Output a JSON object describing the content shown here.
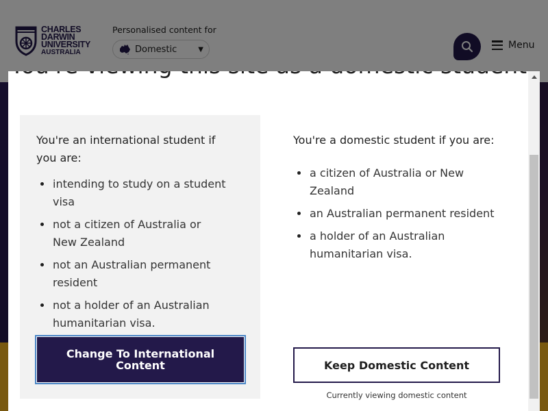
{
  "header": {
    "logo": {
      "line1": "CHARLES",
      "line2": "DARWIN",
      "line3": "UNIVERSITY",
      "line4": "AUSTRALIA"
    },
    "personalise_label": "Personalised content for",
    "audience_select": {
      "selected": "Domestic",
      "icon": "australia-map-icon"
    },
    "search_icon": "search-icon",
    "menu_label": "Menu",
    "brand_color": "#23194a",
    "accent_color": "#f2b321"
  },
  "modal": {
    "heading": "You're viewing this site as a domestic student",
    "international": {
      "title": "You're an international student if you are:",
      "items": [
        "intending to study on a student visa",
        "not a citizen of Australia or New Zealand",
        "not an Australian permanent resident",
        "not a holder of an Australian humanitarian visa."
      ],
      "button_label": "Change To International Content"
    },
    "domestic": {
      "title": "You're a domestic student if you are:",
      "items": [
        "a citizen of Australia or New Zealand",
        "an Australian permanent resident",
        "a holder of an Australian humanitarian visa."
      ],
      "button_label": "Keep Domestic Content",
      "note": "Currently viewing domestic content"
    }
  }
}
